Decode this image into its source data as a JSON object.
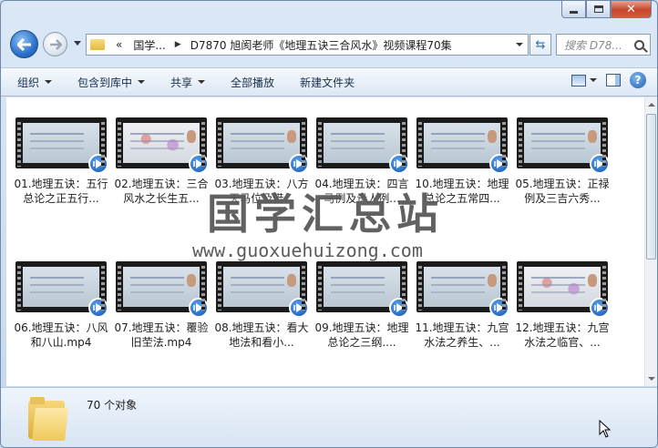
{
  "address": {
    "overflow_marker": "«",
    "segments": [
      "国学...",
      "D7870 旭阂老师《地理五诀三合风水》视频课程70集"
    ]
  },
  "search": {
    "placeholder": "搜索 D78..."
  },
  "toolbar": {
    "items": [
      "组织",
      "包含到库中",
      "共享",
      "全部播放",
      "新建文件夹"
    ]
  },
  "files": [
    {
      "name": "01.地理五诀：五行总论之正五行...",
      "busy": false
    },
    {
      "name": "02.地理五诀：三合风水之长生五...",
      "busy": true
    },
    {
      "name": "03.地理五诀：八方天马位及借...",
      "busy": false
    },
    {
      "name": "04.地理五诀：四言马例及贵人例...",
      "busy": false
    },
    {
      "name": "10.地理五诀：地理总论之五常四...",
      "busy": false
    },
    {
      "name": "05.地理五诀：正禄例及三吉六秀...",
      "busy": false
    },
    {
      "name": "06.地理五诀：八风和八山.mp4",
      "busy": false
    },
    {
      "name": "07.地理五诀：覆验旧茔法.mp4",
      "busy": false
    },
    {
      "name": "08.地理五诀：看大地法和看小...",
      "busy": false
    },
    {
      "name": "09.地理五诀：地理总论之三纲....",
      "busy": false
    },
    {
      "name": "11.地理五诀：九宫水法之养生、...",
      "busy": false
    },
    {
      "name": "12.地理五诀：九宫水法之临官、...",
      "busy": true
    }
  ],
  "watermark": {
    "title": "国学汇总站",
    "url": "www.guoxuehuizong.com"
  },
  "status": {
    "count": "70 个对象"
  },
  "colors": {
    "accent": "#1355b0",
    "toolbar_text": "#1b2e4a"
  }
}
